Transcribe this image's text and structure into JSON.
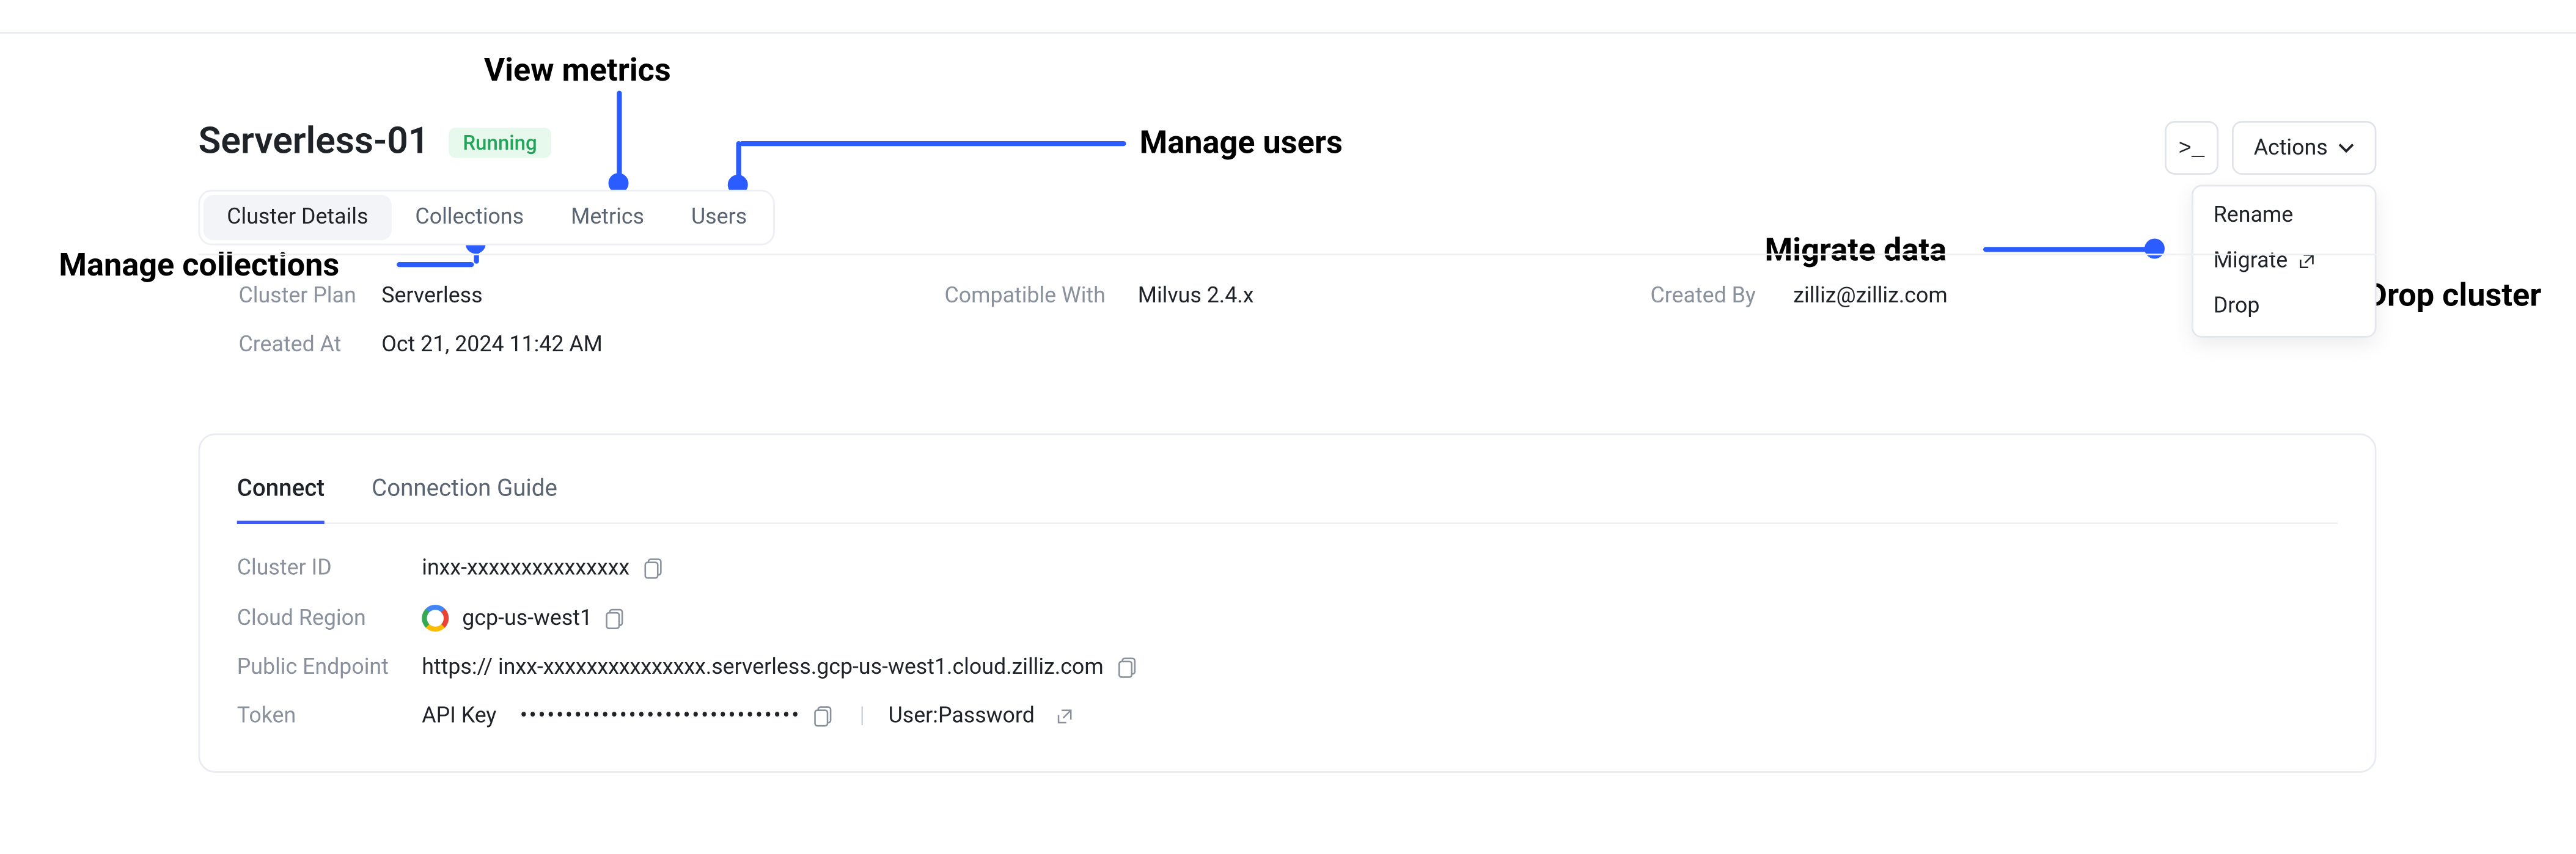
{
  "header": {
    "cluster_name": "Serverless-01",
    "status": "Running",
    "terminal_glyph": ">_",
    "actions_label": "Actions"
  },
  "actions_menu": {
    "rename": "Rename",
    "migrate": "Migrate",
    "drop": "Drop"
  },
  "tabs": {
    "cluster_details": "Cluster Details",
    "collections": "Collections",
    "metrics": "Metrics",
    "users": "Users"
  },
  "info": {
    "plan_label": "Cluster Plan",
    "plan_value": "Serverless",
    "compatible_label": "Compatible With",
    "compatible_value": "Milvus 2.4.x",
    "created_by_label": "Created By",
    "created_by_value": "zilliz@zilliz.com",
    "created_at_label": "Created At",
    "created_at_value": "Oct 21, 2024 11:42 AM"
  },
  "connect": {
    "tab_connect": "Connect",
    "tab_guide": "Connection Guide",
    "cluster_id_label": "Cluster ID",
    "cluster_id_value": "inxx-xxxxxxxxxxxxxxx",
    "region_label": "Cloud Region",
    "region_value": "gcp-us-west1",
    "endpoint_label": "Public Endpoint",
    "endpoint_value": "https:// inxx-xxxxxxxxxxxxxxx.serverless.gcp-us-west1.cloud.zilliz.com",
    "token_label": "Token",
    "token_api_key_label": "API Key",
    "token_masked": "•••••••••••••••••••••••••••••••",
    "token_userpass": "User:Password"
  },
  "annotations": {
    "view_metrics": "View metrics",
    "manage_users": "Manage users",
    "manage_collections": "Manage collections",
    "migrate_data": "Migrate data",
    "drop_cluster": "Drop cluster"
  }
}
